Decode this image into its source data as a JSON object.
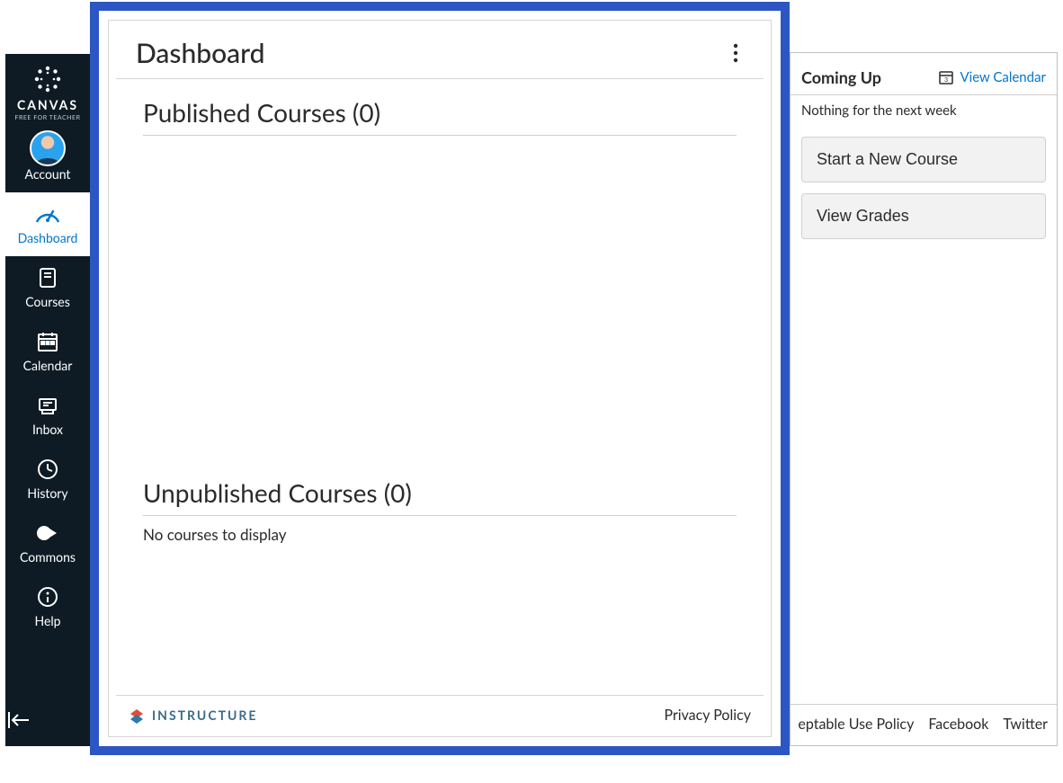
{
  "sidebar": {
    "logo_text": "CANVAS",
    "logo_sub": "FREE FOR TEACHER",
    "items": [
      {
        "label": "Account"
      },
      {
        "label": "Dashboard"
      },
      {
        "label": "Courses"
      },
      {
        "label": "Calendar"
      },
      {
        "label": "Inbox"
      },
      {
        "label": "History"
      },
      {
        "label": "Commons"
      },
      {
        "label": "Help"
      }
    ]
  },
  "main": {
    "title": "Dashboard",
    "published_heading": "Published Courses (0)",
    "unpublished_heading": "Unpublished Courses (0)",
    "empty_message": "No courses to display"
  },
  "footer": {
    "brand": "INSTRUCTURE",
    "privacy": "Privacy Policy"
  },
  "right": {
    "heading": "Coming Up",
    "view_calendar": "View Calendar",
    "nothing": "Nothing for the next week",
    "start_course": "Start a New Course",
    "view_grades": "View Grades",
    "footer_links": {
      "acceptable": "eptable Use Policy",
      "facebook": "Facebook",
      "twitter": "Twitter"
    }
  }
}
